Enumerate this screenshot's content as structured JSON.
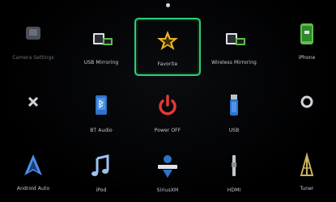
{
  "screen": {
    "page_indicator": "•",
    "selected_item": "favorite"
  },
  "menu": {
    "row1": [
      {
        "name": "camera-settings",
        "label": "Camera Settings",
        "icon": "camera-settings-icon",
        "enabled": false
      },
      {
        "name": "usb-mirroring",
        "label": "USB Mirroring",
        "icon": "usb-mirroring-icon",
        "enabled": true
      },
      {
        "name": "favorite",
        "label": "Favorite",
        "icon": "star-icon",
        "enabled": true
      },
      {
        "name": "wireless-mirroring",
        "label": "Wireless Mirroring",
        "icon": "wireless-mirroring-icon",
        "enabled": true
      },
      {
        "name": "iphone",
        "label": "iPhone",
        "icon": "phone-icon",
        "enabled": true
      }
    ],
    "row2": [
      {
        "name": "close",
        "label": "",
        "icon": "close-icon",
        "enabled": true
      },
      {
        "name": "bt-audio",
        "label": "BT Audio",
        "icon": "bluetooth-audio-icon",
        "enabled": true
      },
      {
        "name": "power-off",
        "label": "Power OFF",
        "icon": "power-icon",
        "enabled": true
      },
      {
        "name": "usb",
        "label": "USB",
        "icon": "usb-icon",
        "enabled": true
      },
      {
        "name": "settings",
        "label": "",
        "icon": "gear-icon",
        "enabled": true
      }
    ],
    "row3": [
      {
        "name": "android-auto",
        "label": "Android Auto",
        "icon": "android-auto-icon",
        "enabled": true
      },
      {
        "name": "ipod",
        "label": "iPod",
        "icon": "music-note-icon",
        "enabled": true
      },
      {
        "name": "siriusxm",
        "label": "SiriusXM",
        "icon": "siriusxm-icon",
        "enabled": true
      },
      {
        "name": "hdmi",
        "label": "HDMI",
        "icon": "hdmi-icon",
        "enabled": true
      },
      {
        "name": "tuner",
        "label": "Tuner",
        "icon": "radio-tower-icon",
        "enabled": true
      }
    ]
  },
  "colors": {
    "selection_border": "#2ecc71",
    "star": "#e8b422",
    "power": "#e53935",
    "usb_green": "#5fbf4a",
    "blue_icon": "#2f73c9"
  }
}
